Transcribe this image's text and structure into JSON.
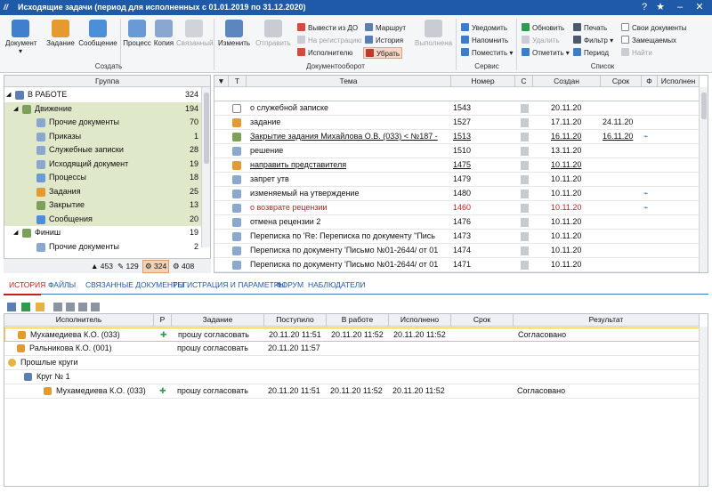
{
  "window": {
    "title": "Исходящие задачи (период для исполненных с 01.01.2019 по 31.12.2020)"
  },
  "ribbon": {
    "groups": {
      "create": "Создать",
      "docflow": "Документооборот",
      "service": "Сервис",
      "list": "Список"
    },
    "create": [
      "Документ",
      "Задание",
      "Сообщение",
      "Процесс",
      "Копия",
      "Связанный"
    ],
    "change": "Изменить",
    "send": "Отправить",
    "docflow_small": {
      "col1": [
        "Вывести из ДО",
        "На регистрацию",
        "Исполнителю"
      ],
      "col2": [
        "Маршрут",
        "История",
        "Убрать"
      ]
    },
    "complete": "Выполнена",
    "service": [
      "Уведомить",
      "Напомнить",
      "Поместить"
    ],
    "list_col1": [
      "Обновить",
      "Удалить",
      "Отметить"
    ],
    "list_col2": [
      "Печать",
      "Фильтр",
      "Период"
    ],
    "list_col3": [
      "Свои документы",
      "Замещаемых",
      "Найти"
    ]
  },
  "left": {
    "header": "Группа",
    "rows": [
      {
        "label": "В РАБОТЕ",
        "count": "324"
      },
      {
        "label": "Движение",
        "count": "194"
      },
      {
        "label": "Прочие документы",
        "count": "70"
      },
      {
        "label": "Приказы",
        "count": "1"
      },
      {
        "label": "Служебные записки",
        "count": "28"
      },
      {
        "label": "Исходящий документ",
        "count": "19"
      },
      {
        "label": "Процессы",
        "count": "18"
      },
      {
        "label": "Задания",
        "count": "25"
      },
      {
        "label": "Закрытие",
        "count": "13"
      },
      {
        "label": "Сообщения",
        "count": "20"
      },
      {
        "label": "Финиш",
        "count": "19"
      },
      {
        "label": "Прочие документы",
        "count": "2"
      }
    ],
    "footer": [
      "453",
      "129",
      "324",
      "408"
    ]
  },
  "grid": {
    "headers": [
      "Т",
      "Тема",
      "Номер",
      "С",
      "Создан",
      "Срок",
      "Ф",
      "Исполнен"
    ],
    "rows": [
      {
        "theme": "о служебной записке",
        "num": "1543",
        "created": "20.11.20",
        "due": ""
      },
      {
        "theme": "задание",
        "num": "1527",
        "created": "17.11.20",
        "due": "24.11.20"
      },
      {
        "theme": "Закрытие задания Михайлова О.В. (033) < №187 -",
        "num": "1513",
        "created": "16.11.20",
        "due": "16.11.20"
      },
      {
        "theme": "решение",
        "num": "1510",
        "created": "13.11.20",
        "due": ""
      },
      {
        "theme": "направить представителя",
        "num": "1475",
        "created": "10.11.20",
        "due": ""
      },
      {
        "theme": "запрет утв",
        "num": "1479",
        "created": "10.11.20",
        "due": ""
      },
      {
        "theme": "изменяемый на утверждение",
        "num": "1480",
        "created": "10.11.20",
        "due": ""
      },
      {
        "theme": "о возврате рецензии",
        "num": "1460",
        "created": "10.11.20",
        "due": ""
      },
      {
        "theme": "отмена рецензии 2",
        "num": "1476",
        "created": "10.11.20",
        "due": ""
      },
      {
        "theme": "Переписка по  'Re: Переписка по  документу \"Пись",
        "num": "1473",
        "created": "10.11.20",
        "due": ""
      },
      {
        "theme": "Переписка по  документу 'Письмо №01-2644/ от 01",
        "num": "1474",
        "created": "10.11.20",
        "due": ""
      },
      {
        "theme": "Переписка по  документу 'Письмо №01-2644/ от 01",
        "num": "1471",
        "created": "10.11.20",
        "due": ""
      }
    ]
  },
  "tabs": [
    "ИСТОРИЯ",
    "ФАЙЛЫ",
    "СВЯЗАННЫЕ ДОКУМЕНТЫ",
    "РЕГИСТРАЦИЯ И ПАРАМЕТРЫ",
    "ФОРУМ",
    "НАБЛЮДАТЕЛИ"
  ],
  "history": {
    "headers": [
      "Исполнитель",
      "Р",
      "Задание",
      "Поступило",
      "В работе",
      "Исполнено",
      "Срок",
      "Результат"
    ],
    "rows": [
      {
        "executor": "Мухамедиева К.О. (033)",
        "task": "прошу согласовать",
        "received": "20.11.20 11:51",
        "inwork": "20.11.20 11:52",
        "done": "20.11.20 11:52",
        "result": "Согласовано"
      },
      {
        "executor": "Ральникова К.О. (001)",
        "task": "прошу согласовать",
        "received": "20.11.20 11:57",
        "inwork": "",
        "done": "",
        "result": ""
      },
      {
        "executor": "Прошлые круги",
        "task": "",
        "received": "",
        "inwork": "",
        "done": "",
        "result": ""
      },
      {
        "executor": "Круг № 1",
        "task": "",
        "received": "",
        "inwork": "",
        "done": "",
        "result": ""
      },
      {
        "executor": "Мухамедиева К.О. (033)",
        "task": "прошу согласовать",
        "received": "20.11.20 11:51",
        "inwork": "20.11.20 11:52",
        "done": "20.11.20 11:52",
        "result": "Согласовано"
      }
    ]
  }
}
